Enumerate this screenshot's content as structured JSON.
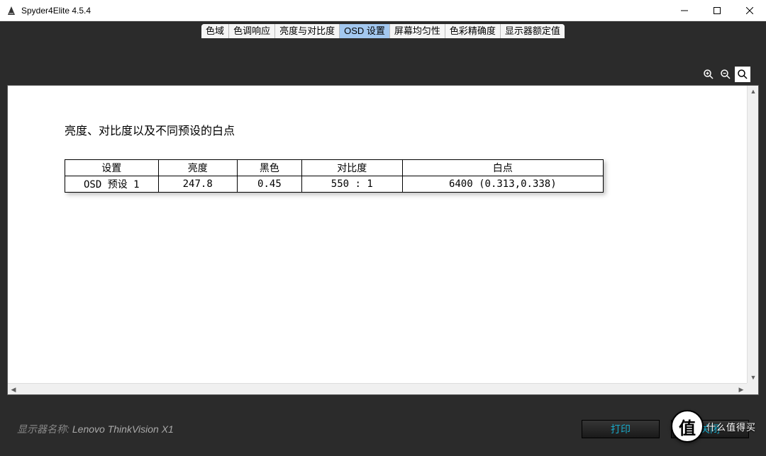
{
  "window": {
    "title": "Spyder4Elite 4.5.4"
  },
  "tabs": [
    {
      "label": "色域",
      "active": false
    },
    {
      "label": "色调响应",
      "active": false
    },
    {
      "label": "亮度与对比度",
      "active": false
    },
    {
      "label": "OSD 设置",
      "active": true
    },
    {
      "label": "屏幕均匀性",
      "active": false
    },
    {
      "label": "色彩精确度",
      "active": false
    },
    {
      "label": "显示器额定值",
      "active": false
    }
  ],
  "content": {
    "heading": "亮度、对比度以及不同预设的白点",
    "table": {
      "headers": [
        "设置",
        "亮度",
        "黑色",
        "对比度",
        "白点"
      ],
      "rows": [
        [
          "OSD 预设 1",
          "247.8",
          "0.45",
          "550 : 1",
          "6400 (0.313,0.338)"
        ]
      ]
    }
  },
  "footer": {
    "label": "显示器名称:",
    "value": "Lenovo ThinkVision X1",
    "print": "打印",
    "close": "关闭"
  },
  "watermark": {
    "badge": "值",
    "text": "什么值得买"
  }
}
